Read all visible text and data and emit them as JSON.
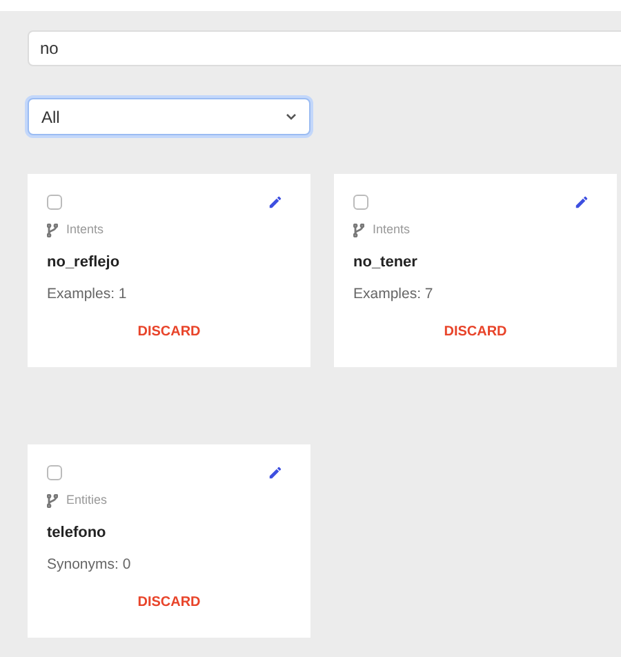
{
  "search": {
    "value": "no"
  },
  "filter": {
    "value": "All"
  },
  "cards": [
    {
      "checked": false,
      "category": "Intents",
      "name": "no_reflejo",
      "count": "Examples: 1",
      "action": "DISCARD"
    },
    {
      "checked": false,
      "category": "Intents",
      "name": "no_tener",
      "count": "Examples: 7",
      "action": "DISCARD"
    },
    {
      "checked": false,
      "category": "Entities",
      "name": "telefono",
      "count": "Synonyms: 0",
      "action": "DISCARD"
    }
  ]
}
